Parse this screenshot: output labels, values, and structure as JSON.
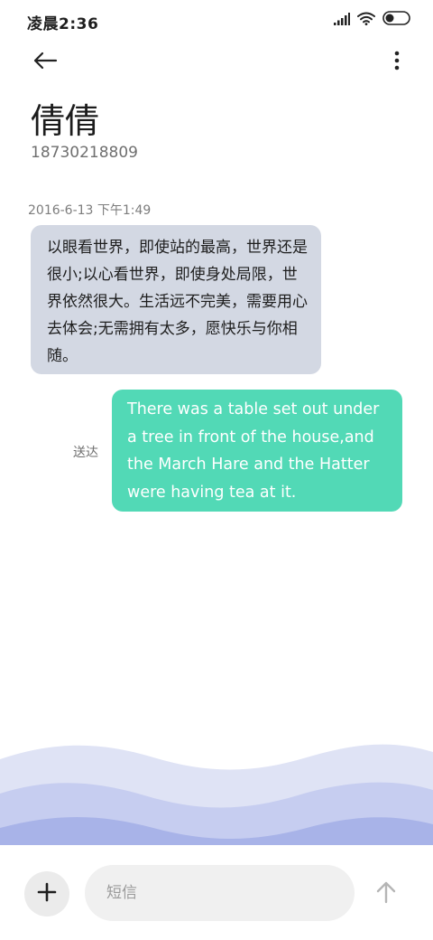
{
  "status_bar": {
    "time": "凌晨2:36",
    "icons": [
      "signal-icon",
      "wifi-icon",
      "battery-icon"
    ]
  },
  "header": {
    "back_icon": "arrow-left-icon",
    "more_icon": "more-vertical-icon"
  },
  "contact": {
    "name": "倩倩",
    "number": "18730218809"
  },
  "messages": [
    {
      "direction": "received",
      "timestamp": "2016-6-13 下午1:49",
      "text": "以眼看世界，即使站的最高，世界还是很小;以心看世界，即使身处局限，世界依然很大。生活远不完美，需要用心去体会;无需拥有太多，愿快乐与你相随。"
    },
    {
      "direction": "sent",
      "status": "送达",
      "text": "There was a table set out under a tree in front of the house,and the March Hare and the Hatter were having tea at it."
    }
  ],
  "composer": {
    "add_icon": "plus-icon",
    "placeholder": "短信",
    "value": "",
    "send_icon": "arrow-up-icon"
  },
  "colors": {
    "received_bubble": "#d3d8e3",
    "sent_bubble": "#52d9b6",
    "wave_light": "#dfe3f5",
    "wave_mid": "#c6cdf0",
    "wave_dark": "#a8b3e8"
  }
}
